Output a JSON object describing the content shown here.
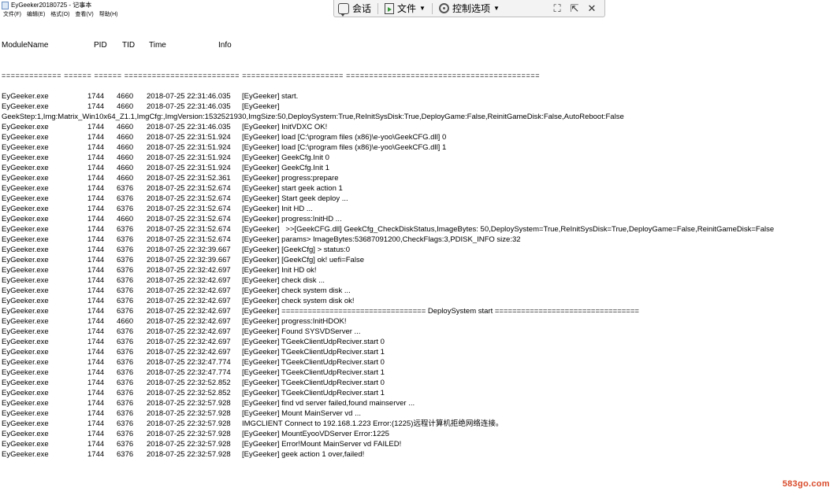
{
  "window": {
    "title": "EyGeeker20180725 - 记事本"
  },
  "menu": [
    "文件(F)",
    "编辑(E)",
    "格式(O)",
    "查看(V)",
    "帮助(H)"
  ],
  "toolbar": {
    "chat_label": "会话",
    "file_label": "文件",
    "control_label": "控制选项",
    "caret": "▼",
    "fit_icon": "⛶",
    "pin_icon": "⇱",
    "close_icon": "✕"
  },
  "log": {
    "headers": [
      "ModuleName",
      "PID",
      "TID",
      "Time",
      "Info"
    ],
    "separator": "============= ====== ====== ========================= ====================== ==========================================",
    "rows": [
      {
        "m": "EyGeeker.exe",
        "p": "1744",
        "t": "4660",
        "time": "2018-07-25 22:31:46.035",
        "info": "[EyGeeker] start."
      },
      {
        "m": "EyGeeker.exe",
        "p": "1744",
        "t": "4660",
        "time": "2018-07-25 22:31:46.035",
        "info": "[EyGeeker]"
      },
      {
        "full": "GeekStep:1,Img:Matrix_Win10x64_Z1.1,ImgCfg:,ImgVersion:1532521930,ImgSize:50,DeploySystem:True,ReInitSysDisk:True,DeployGame:False,ReinitGameDisk:False,AutoReboot:False"
      },
      {
        "m": "EyGeeker.exe",
        "p": "1744",
        "t": "4660",
        "time": "2018-07-25 22:31:46.035",
        "info": "[EyGeeker] InitVDXC OK!"
      },
      {
        "m": "EyGeeker.exe",
        "p": "1744",
        "t": "4660",
        "time": "2018-07-25 22:31:51.924",
        "info": "[EyGeeker] load [C:\\program files (x86)\\e-yoo\\GeekCFG.dll] 0"
      },
      {
        "m": "EyGeeker.exe",
        "p": "1744",
        "t": "4660",
        "time": "2018-07-25 22:31:51.924",
        "info": "[EyGeeker] load [C:\\program files (x86)\\e-yoo\\GeekCFG.dll] 1"
      },
      {
        "m": "EyGeeker.exe",
        "p": "1744",
        "t": "4660",
        "time": "2018-07-25 22:31:51.924",
        "info": "[EyGeeker] GeekCfg.Init 0"
      },
      {
        "m": "EyGeeker.exe",
        "p": "1744",
        "t": "4660",
        "time": "2018-07-25 22:31:51.924",
        "info": "[EyGeeker] GeekCfg.Init 1"
      },
      {
        "m": "EyGeeker.exe",
        "p": "1744",
        "t": "4660",
        "time": "2018-07-25 22:31:52.361",
        "info": "[EyGeeker] progress:prepare"
      },
      {
        "m": "EyGeeker.exe",
        "p": "1744",
        "t": "6376",
        "time": "2018-07-25 22:31:52.674",
        "info": "[EyGeeker] start geek action 1"
      },
      {
        "m": "EyGeeker.exe",
        "p": "1744",
        "t": "6376",
        "time": "2018-07-25 22:31:52.674",
        "info": "[EyGeeker] Start geek deploy ..."
      },
      {
        "m": "EyGeeker.exe",
        "p": "1744",
        "t": "6376",
        "time": "2018-07-25 22:31:52.674",
        "info": "[EyGeeker] Init HD ..."
      },
      {
        "m": "EyGeeker.exe",
        "p": "1744",
        "t": "4660",
        "time": "2018-07-25 22:31:52.674",
        "info": "[EyGeeker] progress:InitHD ..."
      },
      {
        "m": "EyGeeker.exe",
        "p": "1744",
        "t": "6376",
        "time": "2018-07-25 22:31:52.674",
        "info": "[EyGeeker]   >>[GeekCFG.dll] GeekCfg_CheckDiskStatus,ImageBytes: 50,DeploySystem=True,ReInitSysDisk=True,DeployGame=False,ReinitGameDisk=False"
      },
      {
        "m": "EyGeeker.exe",
        "p": "1744",
        "t": "6376",
        "time": "2018-07-25 22:31:52.674",
        "info": "[EyGeeker] params> ImageBytes:53687091200,CheckFlags:3,PDISK_INFO size:32"
      },
      {
        "m": "EyGeeker.exe",
        "p": "1744",
        "t": "6376",
        "time": "2018-07-25 22:32:39.667",
        "info": "[EyGeeker] [GeekCfg] > status:0"
      },
      {
        "m": "EyGeeker.exe",
        "p": "1744",
        "t": "6376",
        "time": "2018-07-25 22:32:39.667",
        "info": "[EyGeeker] [GeekCfg] ok! uefi=False"
      },
      {
        "m": "EyGeeker.exe",
        "p": "1744",
        "t": "6376",
        "time": "2018-07-25 22:32:42.697",
        "info": "[EyGeeker] Init HD ok!"
      },
      {
        "m": "EyGeeker.exe",
        "p": "1744",
        "t": "6376",
        "time": "2018-07-25 22:32:42.697",
        "info": "[EyGeeker] check disk ..."
      },
      {
        "m": "EyGeeker.exe",
        "p": "1744",
        "t": "6376",
        "time": "2018-07-25 22:32:42.697",
        "info": "[EyGeeker] check system disk ..."
      },
      {
        "m": "EyGeeker.exe",
        "p": "1744",
        "t": "6376",
        "time": "2018-07-25 22:32:42.697",
        "info": "[EyGeeker] check system disk ok!"
      },
      {
        "m": "EyGeeker.exe",
        "p": "1744",
        "t": "6376",
        "time": "2018-07-25 22:32:42.697",
        "info": "[EyGeeker] ================================= DeploySystem start ================================="
      },
      {
        "m": "EyGeeker.exe",
        "p": "1744",
        "t": "4660",
        "time": "2018-07-25 22:32:42.697",
        "info": "[EyGeeker] progress:InitHDOK!"
      },
      {
        "m": "EyGeeker.exe",
        "p": "1744",
        "t": "6376",
        "time": "2018-07-25 22:32:42.697",
        "info": "[EyGeeker] Found SYSVDServer ..."
      },
      {
        "m": "EyGeeker.exe",
        "p": "1744",
        "t": "6376",
        "time": "2018-07-25 22:32:42.697",
        "info": "[EyGeeker] TGeekClientUdpReciver.start 0"
      },
      {
        "m": "EyGeeker.exe",
        "p": "1744",
        "t": "6376",
        "time": "2018-07-25 22:32:42.697",
        "info": "[EyGeeker] TGeekClientUdpReciver.start 1"
      },
      {
        "m": "EyGeeker.exe",
        "p": "1744",
        "t": "6376",
        "time": "2018-07-25 22:32:47.774",
        "info": "[EyGeeker] TGeekClientUdpReciver.start 0"
      },
      {
        "m": "EyGeeker.exe",
        "p": "1744",
        "t": "6376",
        "time": "2018-07-25 22:32:47.774",
        "info": "[EyGeeker] TGeekClientUdpReciver.start 1"
      },
      {
        "m": "EyGeeker.exe",
        "p": "1744",
        "t": "6376",
        "time": "2018-07-25 22:32:52.852",
        "info": "[EyGeeker] TGeekClientUdpReciver.start 0"
      },
      {
        "m": "EyGeeker.exe",
        "p": "1744",
        "t": "6376",
        "time": "2018-07-25 22:32:52.852",
        "info": "[EyGeeker] TGeekClientUdpReciver.start 1"
      },
      {
        "m": "EyGeeker.exe",
        "p": "1744",
        "t": "6376",
        "time": "2018-07-25 22:32:57.928",
        "info": "[EyGeeker] find vd server failed,found mainserver ..."
      },
      {
        "m": "EyGeeker.exe",
        "p": "1744",
        "t": "6376",
        "time": "2018-07-25 22:32:57.928",
        "info": "[EyGeeker] Mount MainServer vd ..."
      },
      {
        "m": "EyGeeker.exe",
        "p": "1744",
        "t": "6376",
        "time": "2018-07-25 22:32:57.928",
        "info": "IMGCLIENT Connect to 192.168.1.223 Error:(1225)远程计算机拒绝网络连接。"
      },
      {
        "m": "EyGeeker.exe",
        "p": "1744",
        "t": "6376",
        "time": "2018-07-25 22:32:57.928",
        "info": "[EyGeeker] MountEyooVDServer Error:1225"
      },
      {
        "m": "EyGeeker.exe",
        "p": "1744",
        "t": "6376",
        "time": "2018-07-25 22:32:57.928",
        "info": "[EyGeeker] Error!Mount MainServer vd FAILED!"
      },
      {
        "m": "EyGeeker.exe",
        "p": "1744",
        "t": "6376",
        "time": "2018-07-25 22:32:57.928",
        "info": "[EyGeeker] geek action 1 over,failed!"
      }
    ]
  },
  "watermark": "583go.com",
  "colors": {
    "watermark": "#d94a2a",
    "toolbar_bg": "#f3f3f3"
  }
}
